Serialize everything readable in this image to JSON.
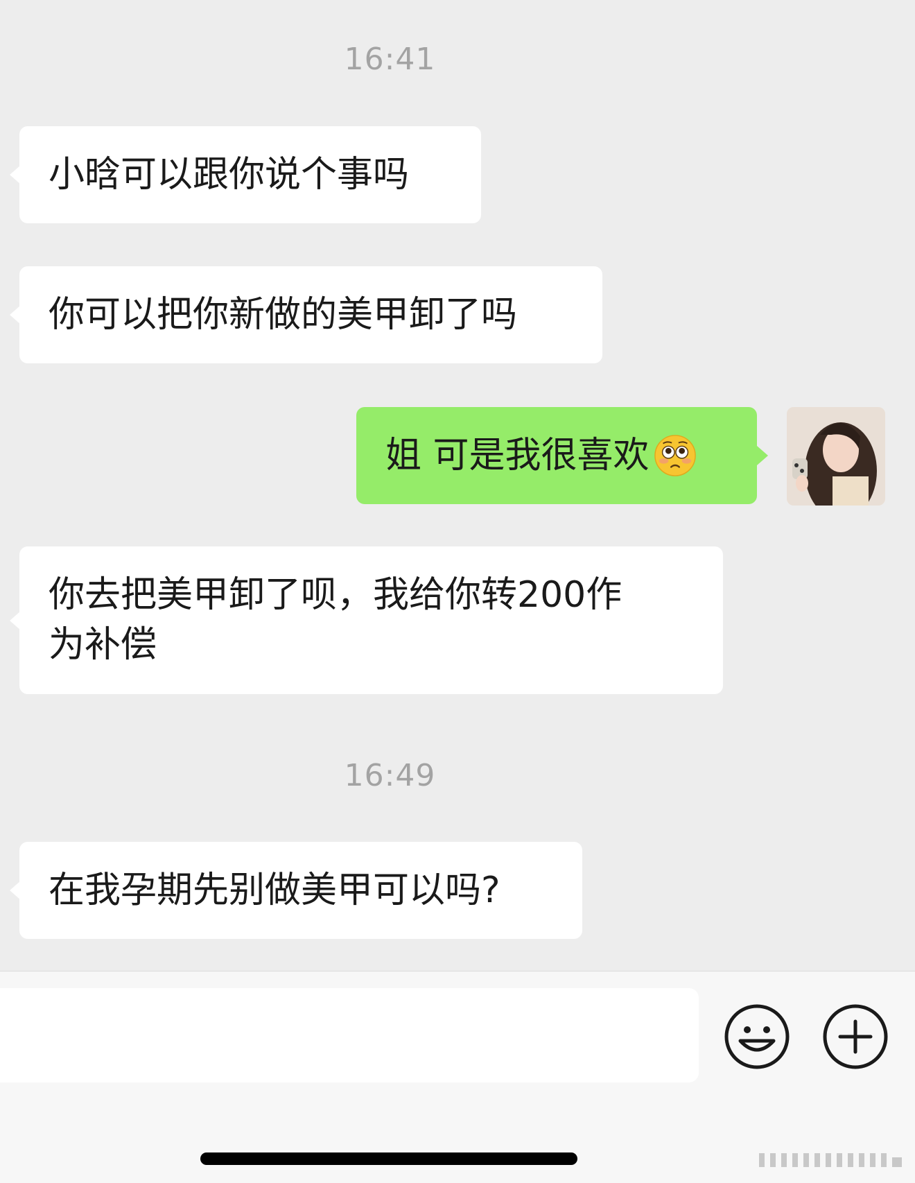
{
  "timestamps": {
    "first": "16:41",
    "second": "16:49"
  },
  "messages": [
    {
      "side": "left",
      "text": "小晗可以跟你说个事吗"
    },
    {
      "side": "left",
      "text": "你可以把你新做的美甲卸了吗"
    },
    {
      "side": "right",
      "text": "姐 可是我很喜欢",
      "emoji": "flushed-pleading-face-emoji"
    },
    {
      "side": "left",
      "line1": "你去把美甲卸了呗，我给你转200作",
      "line2": "为补偿"
    },
    {
      "side": "left",
      "text": "在我孕期先别做美甲可以吗?"
    }
  ],
  "colors": {
    "background": "#ededed",
    "incoming_bubble": "#ffffff",
    "outgoing_bubble": "#95ec69",
    "timestamp_text": "#a3a3a3"
  },
  "input_bar": {
    "icons": [
      "emoji-smile-icon",
      "plus-circle-icon"
    ]
  }
}
